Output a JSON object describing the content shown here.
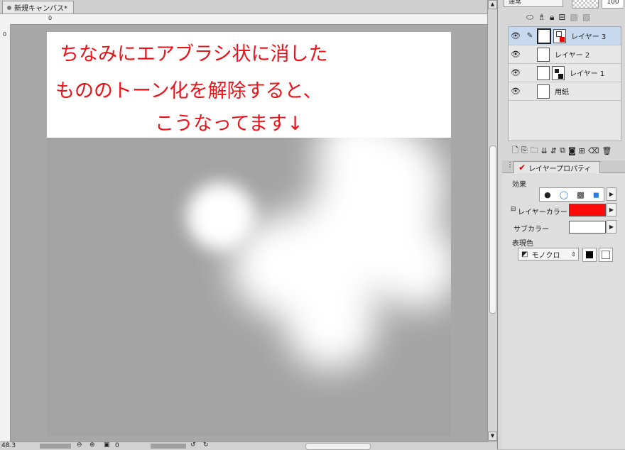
{
  "document": {
    "tab_title": "新規キャンバス*"
  },
  "rulers": {
    "top_origin": "0",
    "left_origin": "0"
  },
  "canvas": {
    "note_lines": [
      "ちなみにエアブラシ状に消した",
      "もののトーン化を解除すると、",
      "こうなってます↓"
    ],
    "note_color": "#e8141b",
    "paper_color": "#a3a3a3"
  },
  "layer_panel": {
    "blend_mode": "通常",
    "opacity": "100",
    "layers": [
      {
        "name": "レイヤー 3",
        "active": true,
        "has_pen": true
      },
      {
        "name": "レイヤー 2",
        "active": false,
        "has_pen": false
      },
      {
        "name": "レイヤー 1",
        "active": false,
        "has_pen": false
      },
      {
        "name": "用紙",
        "active": false,
        "has_pen": false
      }
    ]
  },
  "properties": {
    "tab_label": "レイヤープロパティ",
    "effect_label": "効果",
    "layer_color_label": "レイヤーカラー",
    "layer_color": "#ff0a0a",
    "sub_color_label": "サブカラー",
    "sub_color": "#ffffff",
    "expression_label": "表現色",
    "expression_value": "モノクロ"
  },
  "status": {
    "zoom": "48.3",
    "rotation": "0"
  },
  "icons": [
    "eye-icon",
    "pen-icon",
    "lock-icon",
    "new-layer-icon",
    "delete-icon",
    "scroll-up-icon",
    "scroll-down-icon"
  ]
}
